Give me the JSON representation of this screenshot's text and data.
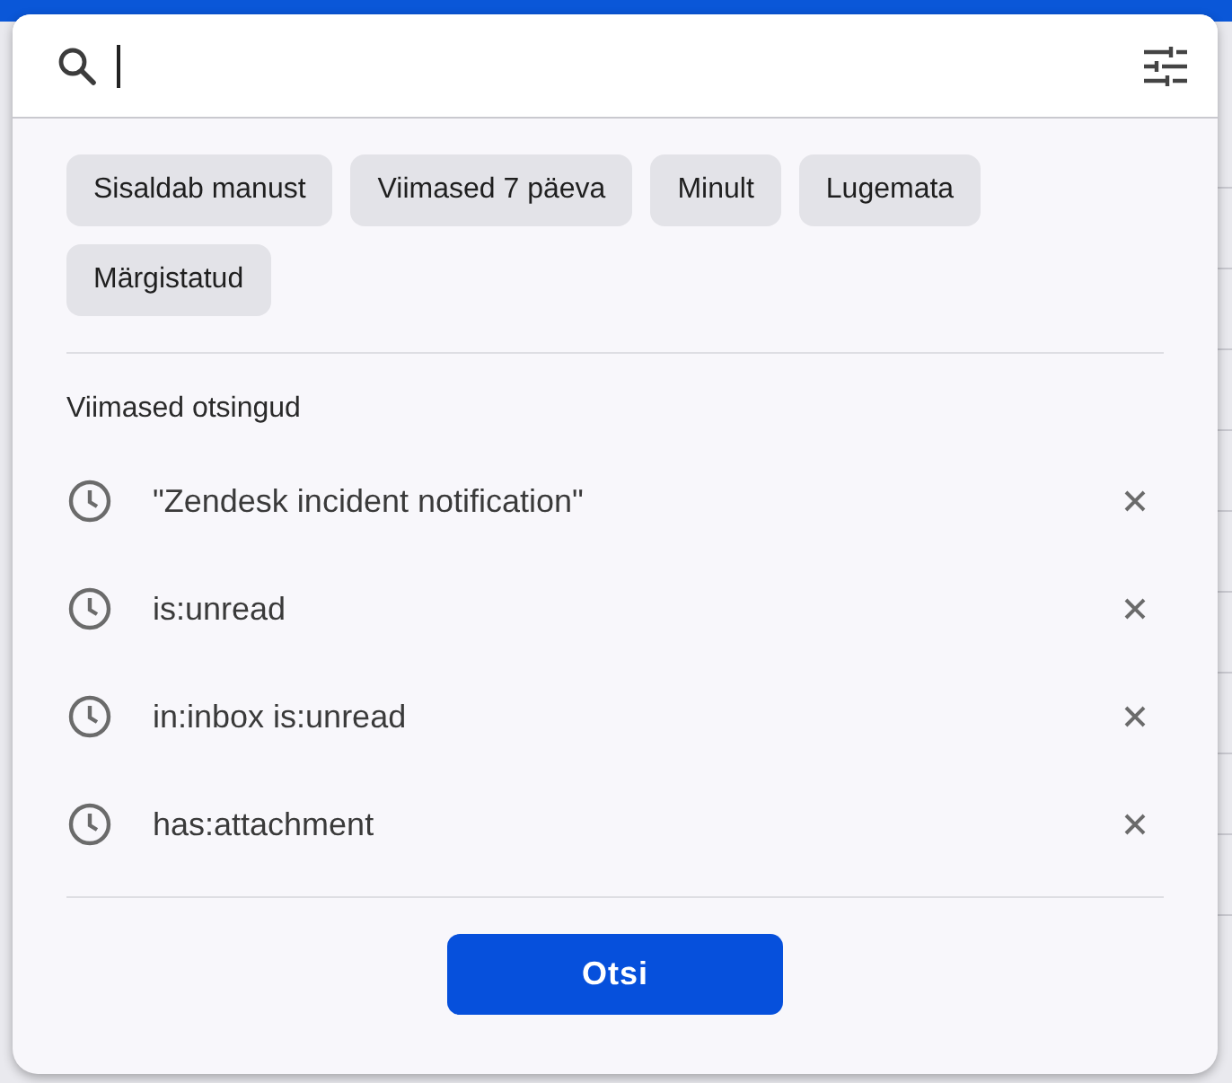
{
  "search": {
    "focused": true
  },
  "filter_chips": [
    "Sisaldab manust",
    "Viimased 7 päeva",
    "Minult",
    "Lugemata",
    "Märgistatud"
  ],
  "recent_searches": {
    "heading": "Viimased otsingud",
    "items": [
      "\"Zendesk incident notification\"",
      "is:unread",
      "in:inbox is:unread",
      "has:attachment"
    ]
  },
  "search_button": "Otsi"
}
